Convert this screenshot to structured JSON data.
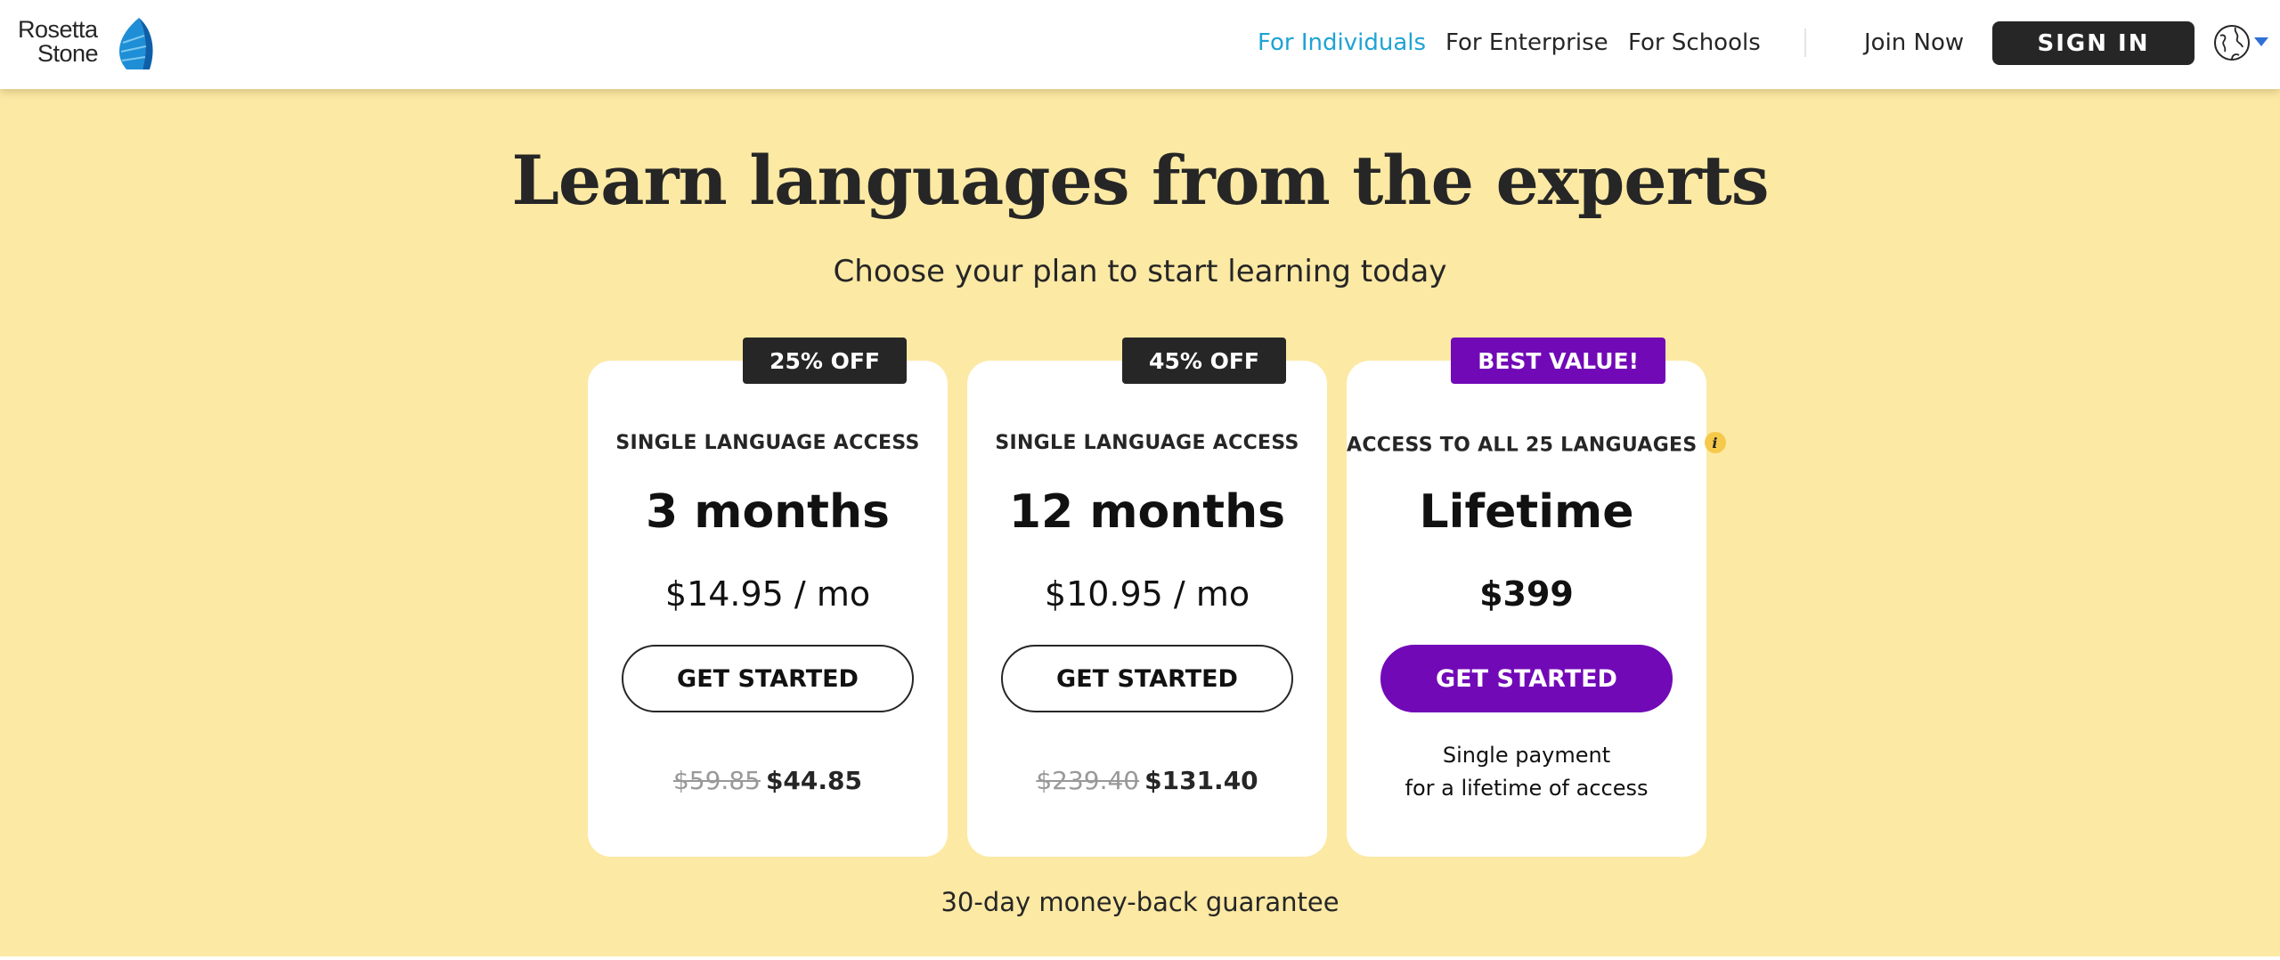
{
  "brand": {
    "logo_line1": "Rosetta",
    "logo_line2": "Stone",
    "accent": "#1fa3d4",
    "background": "#fce9a4",
    "purple": "#7209b7"
  },
  "nav": {
    "items": [
      {
        "label": "For Individuals",
        "active": true
      },
      {
        "label": "For Enterprise",
        "active": false
      },
      {
        "label": "For Schools",
        "active": false
      }
    ],
    "join_label": "Join Now",
    "signin_label": "SIGN IN",
    "language_icon": "globe-icon"
  },
  "hero": {
    "title": "Learn languages from the experts",
    "subtitle": "Choose your plan to start learning today"
  },
  "plans": [
    {
      "badge": "25% OFF",
      "access": "SINGLE LANGUAGE ACCESS",
      "duration": "3 months",
      "price": "$14.95 / mo",
      "cta": "GET STARTED",
      "old_total": "$59.85",
      "new_total": "$44.85"
    },
    {
      "badge": "45% OFF",
      "access": "SINGLE LANGUAGE ACCESS",
      "duration": "12 months",
      "price": "$10.95 / mo",
      "cta": "GET STARTED",
      "old_total": "$239.40",
      "new_total": "$131.40"
    },
    {
      "badge": "BEST VALUE!",
      "access": "ACCESS TO ALL 25 LANGUAGES",
      "info_icon": "i",
      "duration": "Lifetime",
      "price": "$399",
      "cta": "GET STARTED",
      "note_line1": "Single payment",
      "note_line2": "for a lifetime of access"
    }
  ],
  "guarantee": "30-day money-back guarantee"
}
